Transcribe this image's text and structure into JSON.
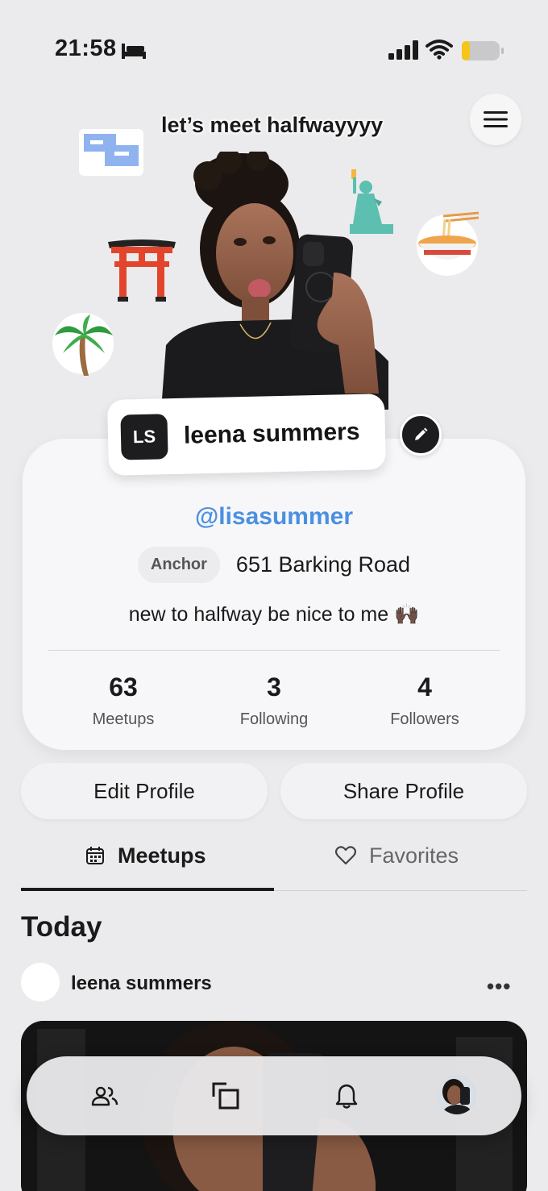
{
  "status_bar": {
    "time": "21:58",
    "battery_color": "#f5c518"
  },
  "header": {
    "tagline": "let’s meet halfwayyyy",
    "menu_icon": "hamburger-icon"
  },
  "stickers": [
    "flags-icon",
    "torii-gate-icon",
    "palm-tree-icon",
    "statue-of-liberty-icon",
    "ramen-bowl-icon"
  ],
  "profile": {
    "initials": "LS",
    "display_name": "leena summers",
    "handle": "@lisasummer",
    "anchor_label": "Anchor",
    "address": "651 Barking Road",
    "bio": "new to halfway be nice to me 🙌🏿",
    "handle_color": "#4a90e2"
  },
  "stats": [
    {
      "value": "63",
      "label": "Meetups"
    },
    {
      "value": "3",
      "label": "Following"
    },
    {
      "value": "4",
      "label": "Followers"
    }
  ],
  "actions": {
    "edit_label": "Edit Profile",
    "share_label": "Share Profile"
  },
  "tabs": [
    {
      "label": "Meetups",
      "icon": "calendar-icon",
      "active": true
    },
    {
      "label": "Favorites",
      "icon": "heart-icon",
      "active": false
    }
  ],
  "feed": {
    "section_title": "Today",
    "post_author": "leena summers",
    "more_label": "•••"
  },
  "bottom_nav": [
    "friends-icon",
    "meetup-icon",
    "bell-icon",
    "profile-avatar"
  ]
}
